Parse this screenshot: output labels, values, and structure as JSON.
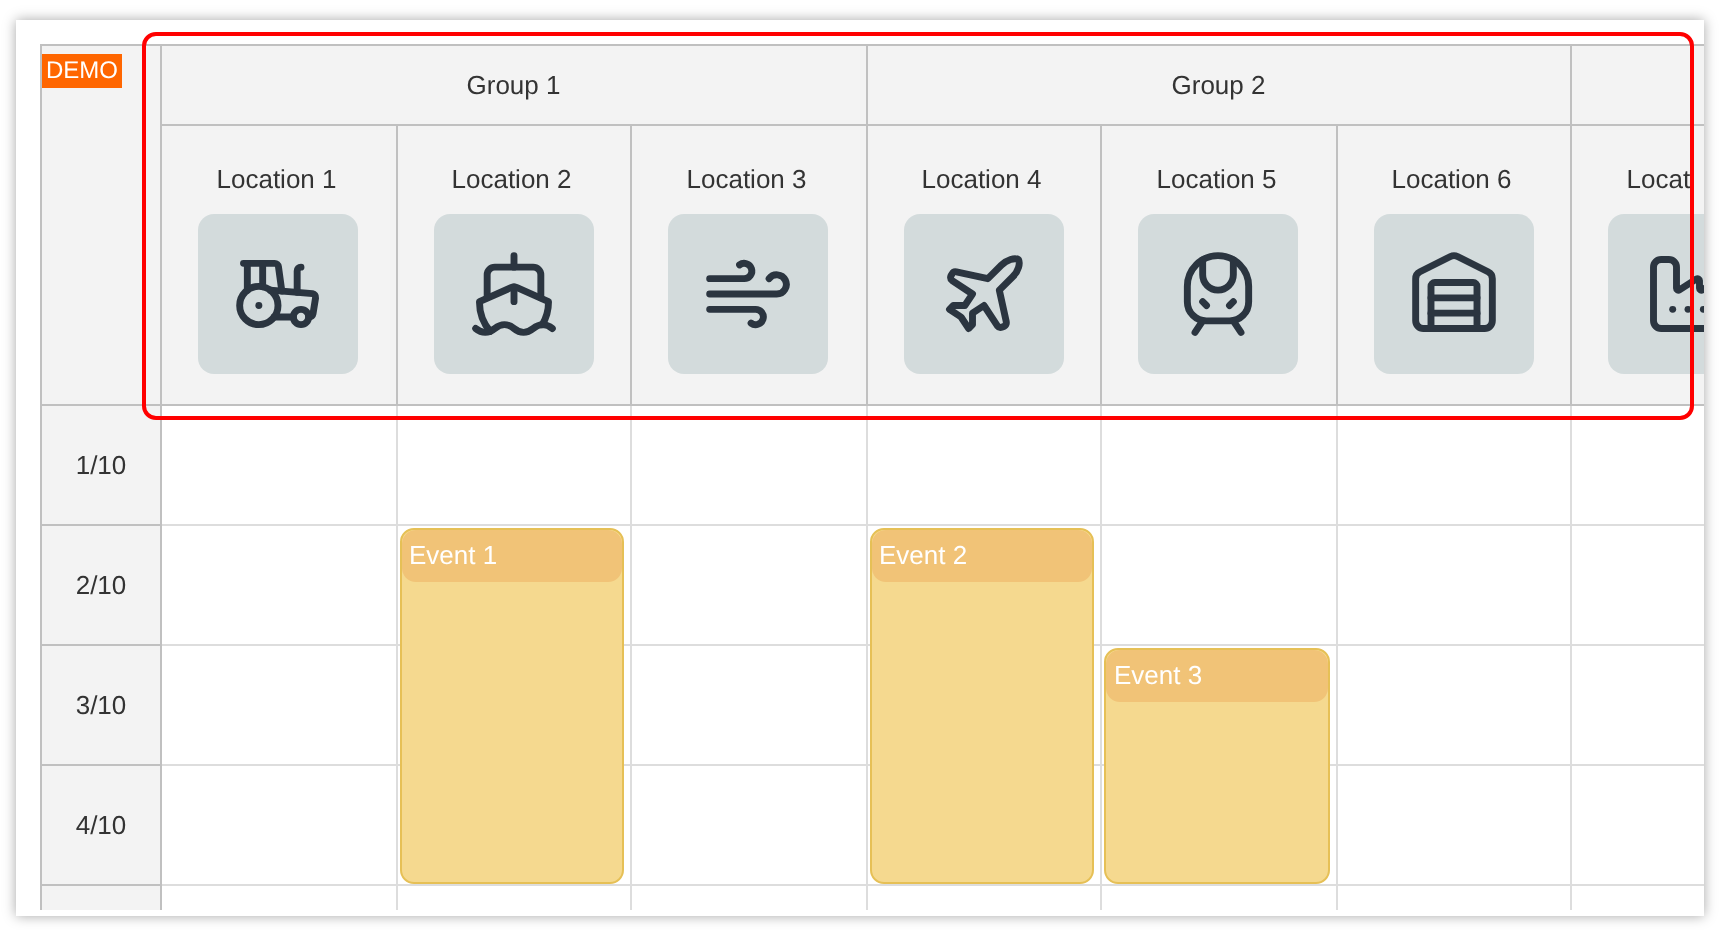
{
  "badge": "DEMO",
  "groups": [
    {
      "label": "Group 1"
    },
    {
      "label": "Group 2"
    }
  ],
  "locations": [
    {
      "label": "Location 1",
      "kind": "construction"
    },
    {
      "label": "Location 2",
      "kind": "port"
    },
    {
      "label": "Location 3",
      "kind": "wind"
    },
    {
      "label": "Location 4",
      "kind": "airport"
    },
    {
      "label": "Location 5",
      "kind": "rail"
    },
    {
      "label": "Location 6",
      "kind": "warehouse"
    },
    {
      "label": "Locat",
      "kind": "factory"
    }
  ],
  "rows": [
    {
      "label": "1/10"
    },
    {
      "label": "2/10"
    },
    {
      "label": "3/10"
    },
    {
      "label": "4/10"
    }
  ],
  "events": [
    {
      "title": "Event 1"
    },
    {
      "title": "Event 2"
    },
    {
      "title": "Event 3"
    }
  ],
  "highlight": true
}
